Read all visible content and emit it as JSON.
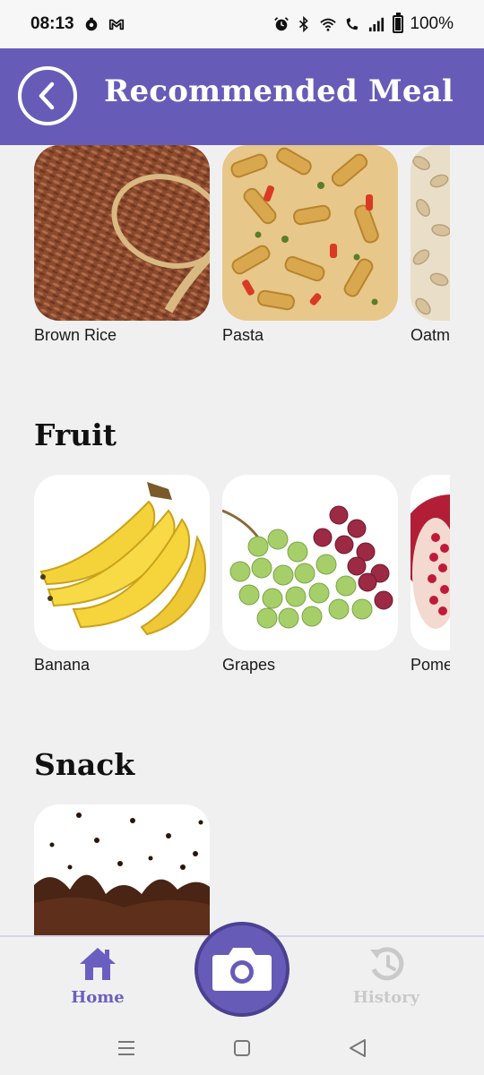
{
  "status_bar": {
    "time": "08:13",
    "battery": "100%"
  },
  "header": {
    "title": "Recommended Meal"
  },
  "sections": [
    {
      "title": "",
      "items": [
        {
          "label": "Brown Rice"
        },
        {
          "label": "Pasta"
        },
        {
          "label": "Oatm"
        }
      ]
    },
    {
      "title": "Fruit",
      "items": [
        {
          "label": "Banana"
        },
        {
          "label": "Grapes"
        },
        {
          "label": "Pome"
        }
      ]
    },
    {
      "title": "Snack",
      "items": [
        {
          "label": ""
        }
      ]
    }
  ],
  "bottom_nav": {
    "home_label": "Home",
    "history_label": "History"
  },
  "colors": {
    "primary": "#665cb8",
    "home_active": "#6a5fc1",
    "history_inactive": "#c9c9c9",
    "background": "#f1f0f1"
  },
  "icons": {
    "back": "chevron-left-icon",
    "home": "home-icon",
    "camera": "camera-icon",
    "history": "history-icon"
  }
}
